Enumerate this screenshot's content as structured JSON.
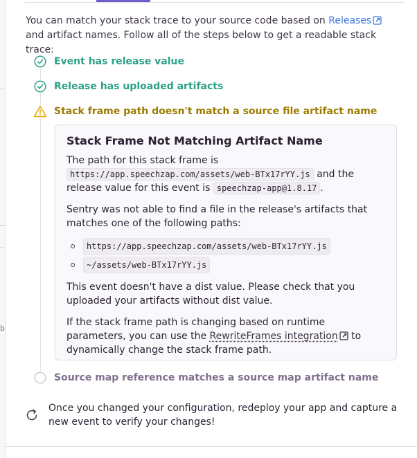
{
  "intro": {
    "text_before": "You can match your stack trace to your source code based on ",
    "releases_link": "Releases",
    "text_after": " and artifact names. Follow all of the steps below to get a readable stack trace:"
  },
  "steps": [
    {
      "label": "Event has release value",
      "status": "ok"
    },
    {
      "label": "Release has uploaded artifacts",
      "status": "ok"
    },
    {
      "label": "Stack frame path doesn't match a source file artifact name",
      "status": "warning"
    },
    {
      "label": "Source map reference matches a source map artifact name",
      "status": "pending"
    }
  ],
  "panel": {
    "title": "Stack Frame Not Matching Artifact Name",
    "p1_a": "The path for this stack frame is ",
    "p1_path": "https://app.speechzap.com/assets/web-BTx17rYY.js",
    "p1_b": " and the release value for this event is ",
    "p1_release": "speechzap-app@1.8.17",
    "p1_c": ".",
    "p2": "Sentry was not able to find a file in the release's artifacts that matches one of the following paths:",
    "paths": [
      "https://app.speechzap.com/assets/web-BTx17rYY.js",
      "~/assets/web-BTx17rYY.js"
    ],
    "p3": "This event doesn't have a dist value. Please check that you uploaded your artifacts without dist value.",
    "p4_a": "If the stack frame path is changing based on runtime parameters, you can use the ",
    "p4_link": "RewriteFrames integration",
    "p4_b": " to dynamically change the stack frame path."
  },
  "footer": {
    "text": "Once you changed your configuration, redeploy your app and capture a new event to verify your changes!"
  },
  "left_edge_glyph": "b",
  "colors": {
    "ok": "#2ba185",
    "warning": "#9c7a00",
    "pending": "#80708f",
    "link": "#3d74db",
    "accent": "#6c5fc7"
  }
}
